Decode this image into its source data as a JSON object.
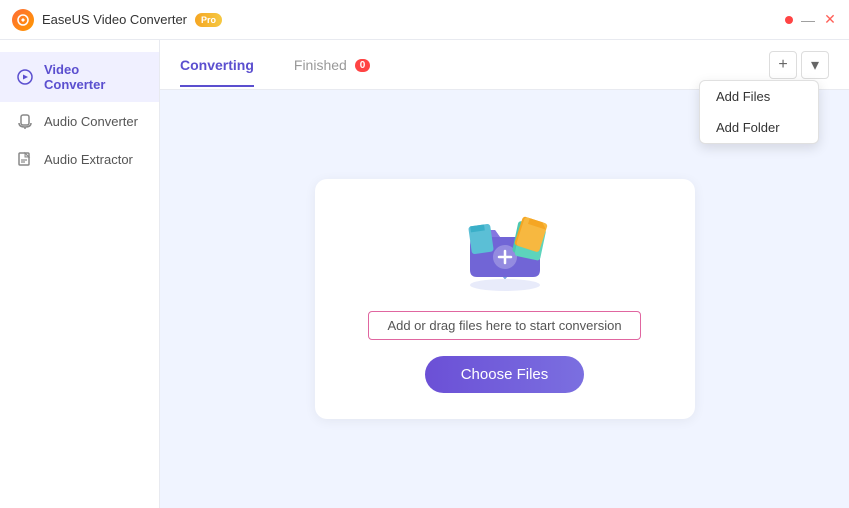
{
  "titleBar": {
    "appName": "EaseUS Video Converter",
    "proBadge": "Pro",
    "minBtn": "—",
    "closeBtn": "✕"
  },
  "sidebar": {
    "items": [
      {
        "id": "video-converter",
        "label": "Video Converter",
        "active": true
      },
      {
        "id": "audio-converter",
        "label": "Audio Converter",
        "active": false
      },
      {
        "id": "audio-extractor",
        "label": "Audio Extractor",
        "active": false
      }
    ]
  },
  "tabs": {
    "converting": "Converting",
    "finished": "Finished",
    "finishedBadge": "0"
  },
  "dropdown": {
    "addFiles": "Add Files",
    "addFolder": "Add Folder"
  },
  "dropZone": {
    "text": "Add or drag files here to start conversion",
    "chooseBtn": "Choose Files"
  }
}
